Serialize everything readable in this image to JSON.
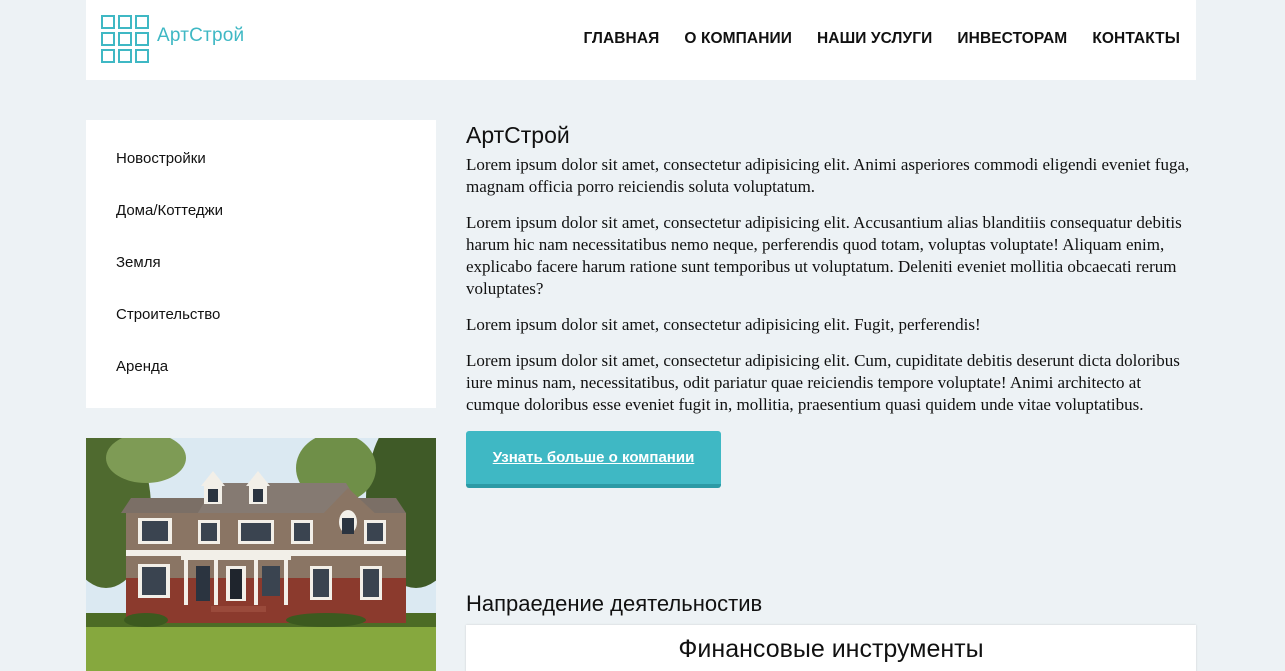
{
  "header": {
    "logo_text": "АртСтрой",
    "nav": [
      "ГЛАВНАЯ",
      "О КОМПАНИИ",
      "НАШИ УСЛУГИ",
      "ИНВЕСТОРАМ",
      "КОНТАКТЫ"
    ]
  },
  "sidebar": {
    "items": [
      "Новостройки",
      "Дома/Коттеджи",
      "Земля",
      "Строительство",
      "Аренда"
    ]
  },
  "main": {
    "title": "АртСтрой",
    "paragraphs": [
      "Lorem ipsum dolor sit amet, consectetur adipisicing elit. Animi asperiores commodi eligendi eveniet fuga, magnam officia porro reiciendis soluta voluptatum.",
      "Lorem ipsum dolor sit amet, consectetur adipisicing elit. Accusantium alias blanditiis consequatur debitis harum hic nam necessitatibus nemo neque, perferendis quod totam, voluptas voluptate! Aliquam enim, explicabo facere harum ratione sunt temporibus ut voluptatum. Deleniti eveniet mollitia obcaecati rerum voluptates?",
      "Lorem ipsum dolor sit amet, consectetur adipisicing elit. Fugit, perferendis!",
      "Lorem ipsum dolor sit amet, consectetur adipisicing elit. Cum, cupiditate debitis deserunt dicta doloribus iure minus nam, necessitatibus, odit pariatur quae reiciendis tempore voluptate! Animi architecto at cumque doloribus esse eveniet fugit in, mollitia, praesentium quasi quidem unde vitae voluptatibus."
    ],
    "button_label": "Узнать больше о компании",
    "section_title": "Напраедение деятельностив",
    "card_title": "Финансовые инструменты"
  },
  "colors": {
    "accent": "#3fb8c4",
    "background": "#edf2f5"
  }
}
